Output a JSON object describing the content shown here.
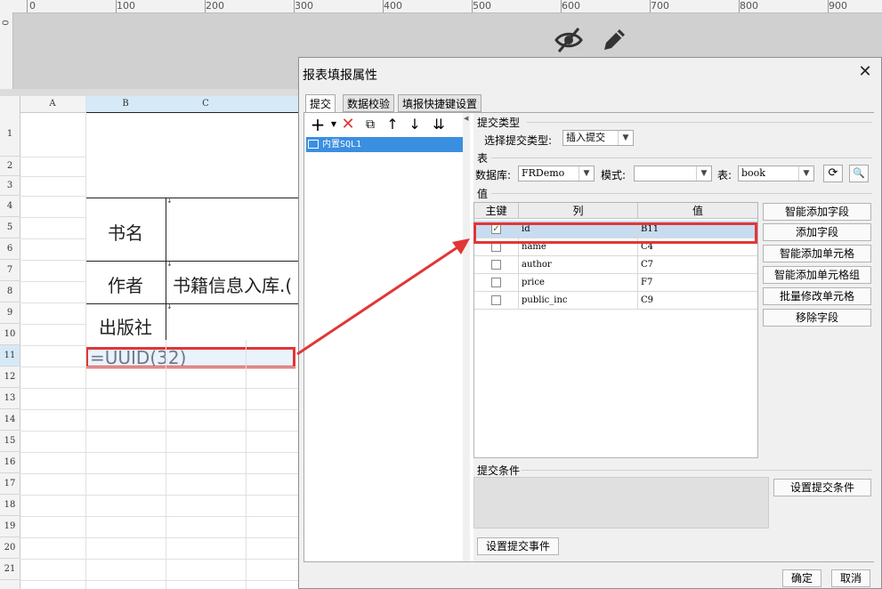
{
  "ruler": {
    "labels": [
      "0",
      "100",
      "200",
      "300",
      "400",
      "500",
      "600",
      "700",
      "800",
      "900"
    ],
    "left_label": "0"
  },
  "toolbar_icons": [
    "eye-off-icon",
    "pencil-icon"
  ],
  "sheet": {
    "columns": [
      "A",
      "B",
      "C"
    ],
    "rows": [
      "1",
      "2",
      "3",
      "4",
      "5",
      "6",
      "7",
      "8",
      "9",
      "10",
      "11",
      "12",
      "13",
      "14",
      "15",
      "16",
      "17",
      "18",
      "19",
      "20",
      "21"
    ],
    "cells": {
      "book_name": "书名",
      "author": "作者",
      "publisher": "出版社",
      "author_value": "书籍信息入库.(",
      "formula": "=UUID(32)"
    }
  },
  "dialog": {
    "title": "报表填报属性",
    "close": "✕",
    "tabs": [
      "提交",
      "数据校验",
      "填报快捷键设置"
    ],
    "sql_item": "内置SQL1",
    "submit_type_section": "提交类型",
    "submit_type_label": "选择提交类型:",
    "submit_type_value": "插入提交",
    "table_section": "表",
    "db_label": "数据库:",
    "db_value": "FRDemo",
    "mode_label": "模式:",
    "mode_value": "",
    "table_label": "表:",
    "table_value": "book",
    "value_section": "值",
    "grid_headers": [
      "主键",
      "列",
      "值"
    ],
    "grid_rows": [
      {
        "key": true,
        "column": "id",
        "value": "B11"
      },
      {
        "key": false,
        "column": "name",
        "value": "C4"
      },
      {
        "key": false,
        "column": "author",
        "value": "C7"
      },
      {
        "key": false,
        "column": "price",
        "value": "F7"
      },
      {
        "key": false,
        "column": "public_inc",
        "value": "C9"
      }
    ],
    "side_buttons": [
      "智能添加字段",
      "添加字段",
      "智能添加单元格",
      "智能添加单元格组",
      "批量修改单元格",
      "移除字段"
    ],
    "condition_section": "提交条件",
    "set_condition": "设置提交条件",
    "set_event": "设置提交事件",
    "ok": "确定",
    "cancel": "取消"
  },
  "colors": {
    "highlight": "#e13636",
    "selection": "#3b8fe0"
  }
}
